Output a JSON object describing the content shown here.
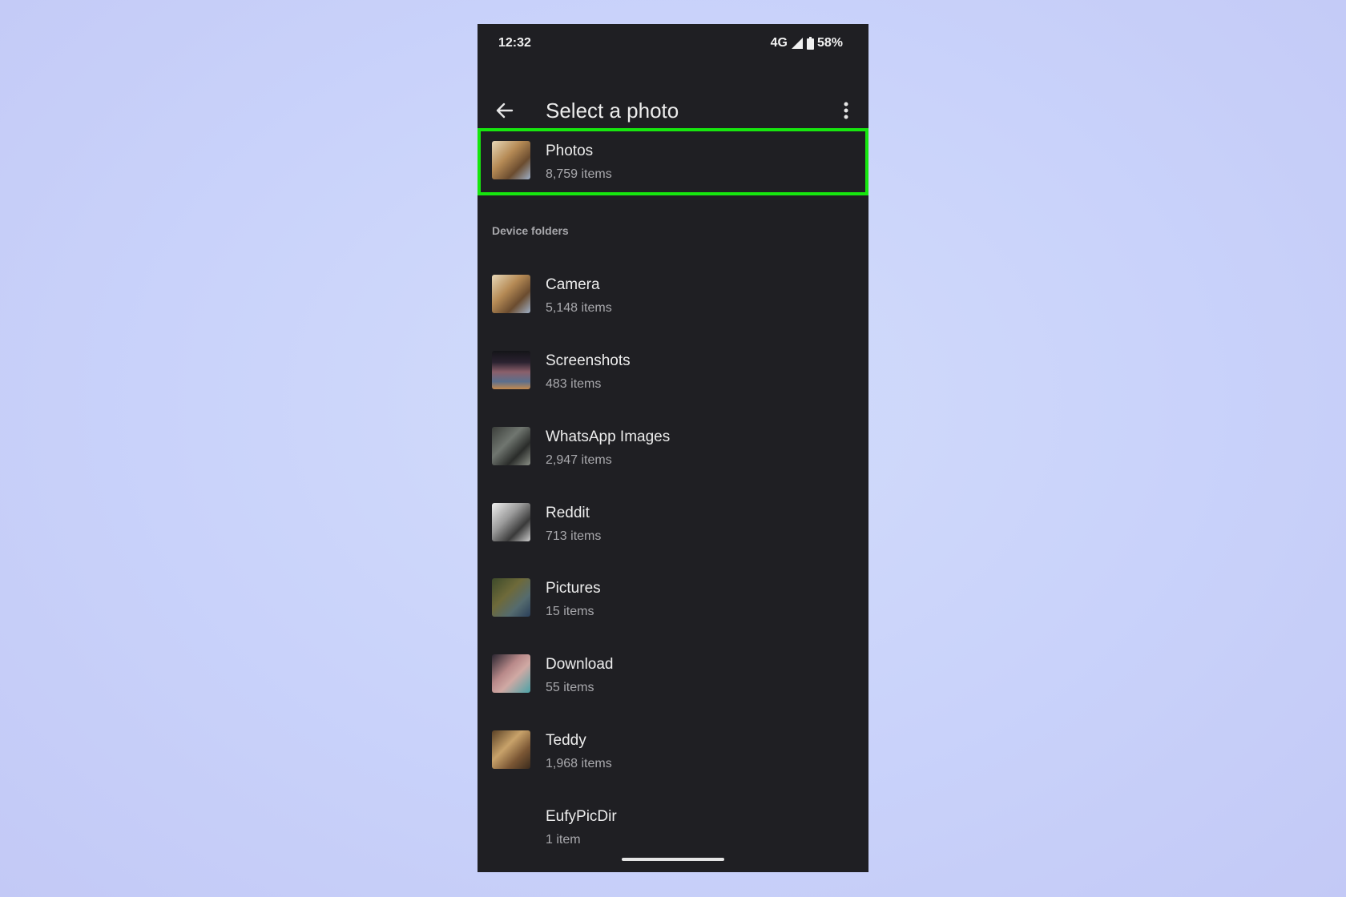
{
  "status_bar": {
    "time": "12:32",
    "network": "4G",
    "battery": "58%"
  },
  "app_bar": {
    "title": "Select a photo",
    "back_icon": "arrow-back-icon",
    "menu_icon": "more-vert-icon"
  },
  "highlight_color": "#17e60f",
  "top_album": {
    "name": "Photos",
    "count": "8,759 items"
  },
  "section": {
    "title": "Device folders"
  },
  "folders": [
    {
      "name": "Camera",
      "count": "5,148 items"
    },
    {
      "name": "Screenshots",
      "count": "483 items"
    },
    {
      "name": "WhatsApp Images",
      "count": "2,947 items"
    },
    {
      "name": "Reddit",
      "count": "713 items"
    },
    {
      "name": "Pictures",
      "count": "15 items"
    },
    {
      "name": "Download",
      "count": "55 items"
    },
    {
      "name": "Teddy",
      "count": "1,968 items"
    },
    {
      "name": "EufyPicDir",
      "count": "1 item"
    }
  ]
}
